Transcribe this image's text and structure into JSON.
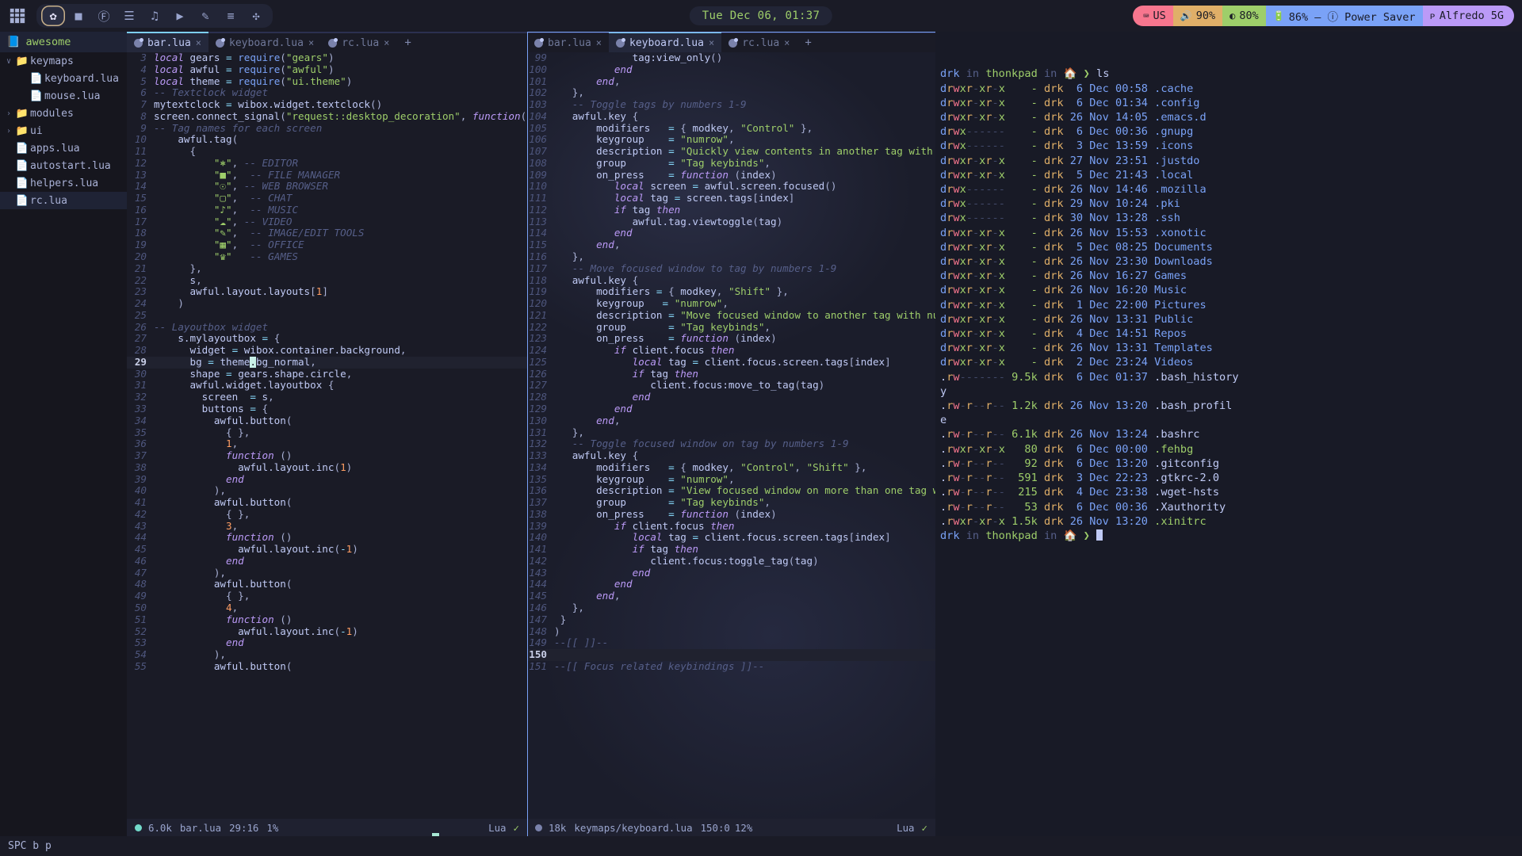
{
  "topbar": {
    "launcher_icon": "grid-apps-icon",
    "tags": [
      {
        "icon": "✿",
        "name": "editor-tag",
        "glyph": "emacs-icon",
        "active": true
      },
      {
        "icon": "■",
        "name": "file-manager-tag",
        "glyph": "folder-icon",
        "active": false
      },
      {
        "icon": "Ⓕ",
        "name": "web-browser-tag",
        "glyph": "firefox-icon",
        "active": false
      },
      {
        "icon": "☰",
        "name": "chat-tag",
        "glyph": "chat-icon",
        "active": false
      },
      {
        "icon": "♫",
        "name": "music-tag",
        "glyph": "music-icon",
        "active": false
      },
      {
        "icon": "▶",
        "name": "video-tag",
        "glyph": "video-icon",
        "active": false
      },
      {
        "icon": "✎",
        "name": "image-edit-tag",
        "glyph": "pencil-icon",
        "active": false
      },
      {
        "icon": "≡",
        "name": "office-tag",
        "glyph": "document-icon",
        "active": false
      },
      {
        "icon": "✣",
        "name": "games-tag",
        "glyph": "gamepad-icon",
        "active": false
      }
    ],
    "clock": "Tue Dec 06, 01:37",
    "tray": [
      {
        "name": "keyboard-layout",
        "icon": "⌨",
        "label": "US",
        "bg": "#f7768e"
      },
      {
        "name": "volume",
        "icon": "🔊",
        "label": "90%",
        "bg": "#e0af68"
      },
      {
        "name": "brightness",
        "icon": "◐",
        "label": "80%",
        "bg": "#9ece6a"
      },
      {
        "name": "battery",
        "icon": "🔋",
        "label": "86% – ⓘ Power Saver",
        "bg": "#7aa2f7"
      },
      {
        "name": "wifi",
        "icon": "ᴘ",
        "label": "Alfredo 5G",
        "bg": "#bb9af7"
      }
    ]
  },
  "sidebar": {
    "root": {
      "label": "awesome",
      "icon": "book-icon"
    },
    "items": [
      {
        "label": "keymaps",
        "type": "folder",
        "chev": "∨",
        "indent": 0,
        "selected": false
      },
      {
        "label": "keyboard.lua",
        "type": "file",
        "chev": "",
        "indent": 1,
        "selected": false
      },
      {
        "label": "mouse.lua",
        "type": "file",
        "chev": "",
        "indent": 1,
        "selected": false
      },
      {
        "label": "modules",
        "type": "folder",
        "chev": "›",
        "indent": 0,
        "selected": false
      },
      {
        "label": "ui",
        "type": "folder",
        "chev": "›",
        "indent": 0,
        "selected": false
      },
      {
        "label": "apps.lua",
        "type": "file",
        "chev": "",
        "indent": 0,
        "selected": false
      },
      {
        "label": "autostart.lua",
        "type": "file",
        "chev": "",
        "indent": 0,
        "selected": false
      },
      {
        "label": "helpers.lua",
        "type": "file",
        "chev": "",
        "indent": 0,
        "selected": false
      },
      {
        "label": "rc.lua",
        "type": "file",
        "chev": "",
        "indent": 0,
        "selected": true
      }
    ]
  },
  "editor_left": {
    "tabs": [
      {
        "label": "bar.lua",
        "active": true,
        "close": "×"
      },
      {
        "label": "keyboard.lua",
        "active": false,
        "close": "×"
      },
      {
        "label": "rc.lua",
        "active": false,
        "close": "×"
      }
    ],
    "tab_add": "+",
    "first_line": 3,
    "cursor_line": 29,
    "statusline": {
      "dot_color": "#73daca",
      "size": "6.0k",
      "file": "bar.lua",
      "position": "29:16",
      "percent": "1%",
      "filetype": "Lua",
      "check": "✓"
    }
  },
  "editor_right": {
    "tabs": [
      {
        "label": "bar.lua",
        "active": false,
        "close": "×"
      },
      {
        "label": "keyboard.lua",
        "active": true,
        "close": "×"
      },
      {
        "label": "rc.lua",
        "active": false,
        "close": "×"
      }
    ],
    "tab_add": "+",
    "first_line": 99,
    "cursor_line": 150,
    "statusline": {
      "dot_color": "#7a82ab",
      "size": "18k",
      "file": "keymaps/keyboard.lua",
      "position": "150:0",
      "percent": "12%",
      "filetype": "Lua",
      "check": "✓"
    }
  },
  "terminal": {
    "prompt_user": "drk",
    "prompt_in": "in",
    "prompt_host": "thonkpad",
    "prompt_in2": "in",
    "prompt_dir_icon": "🏠",
    "prompt_arrow": "❯",
    "command": "ls",
    "entries": [
      {
        "perm": "drwxr-xr-x",
        "size": "-",
        "owner": "drk",
        "date": " 6 Dec 00:58",
        "name": ".cache",
        "color": "blue"
      },
      {
        "perm": "drwxr-xr-x",
        "size": "-",
        "owner": "drk",
        "date": " 6 Dec 01:34",
        "name": ".config",
        "color": "blue"
      },
      {
        "perm": "drwxr-xr-x",
        "size": "-",
        "owner": "drk",
        "date": "26 Nov 14:05",
        "name": ".emacs.d",
        "color": "blue"
      },
      {
        "perm": "drwx------",
        "size": "-",
        "owner": "drk",
        "date": " 6 Dec 00:36",
        "name": ".gnupg",
        "color": "blue"
      },
      {
        "perm": "drwx------",
        "size": "-",
        "owner": "drk",
        "date": " 3 Dec 13:59",
        "name": ".icons",
        "color": "blue"
      },
      {
        "perm": "drwxr-xr-x",
        "size": "-",
        "owner": "drk",
        "date": "27 Nov 23:51",
        "name": ".justdo",
        "color": "blue"
      },
      {
        "perm": "drwxr-xr-x",
        "size": "-",
        "owner": "drk",
        "date": " 5 Dec 21:43",
        "name": ".local",
        "color": "blue"
      },
      {
        "perm": "drwx------",
        "size": "-",
        "owner": "drk",
        "date": "26 Nov 14:46",
        "name": ".mozilla",
        "color": "blue"
      },
      {
        "perm": "drwx------",
        "size": "-",
        "owner": "drk",
        "date": "29 Nov 10:24",
        "name": ".pki",
        "color": "blue"
      },
      {
        "perm": "drwx------",
        "size": "-",
        "owner": "drk",
        "date": "30 Nov 13:28",
        "name": ".ssh",
        "color": "blue"
      },
      {
        "perm": "drwxr-xr-x",
        "size": "-",
        "owner": "drk",
        "date": "26 Nov 15:53",
        "name": ".xonotic",
        "color": "blue"
      },
      {
        "perm": "drwxr-xr-x",
        "size": "-",
        "owner": "drk",
        "date": " 5 Dec 08:25",
        "name": "Documents",
        "color": "blue"
      },
      {
        "perm": "drwxr-xr-x",
        "size": "-",
        "owner": "drk",
        "date": "26 Nov 23:30",
        "name": "Downloads",
        "color": "blue"
      },
      {
        "perm": "drwxr-xr-x",
        "size": "-",
        "owner": "drk",
        "date": "26 Nov 16:27",
        "name": "Games",
        "color": "blue"
      },
      {
        "perm": "drwxr-xr-x",
        "size": "-",
        "owner": "drk",
        "date": "26 Nov 16:20",
        "name": "Music",
        "color": "blue"
      },
      {
        "perm": "drwxr-xr-x",
        "size": "-",
        "owner": "drk",
        "date": " 1 Dec 22:00",
        "name": "Pictures",
        "color": "blue"
      },
      {
        "perm": "drwxr-xr-x",
        "size": "-",
        "owner": "drk",
        "date": "26 Nov 13:31",
        "name": "Public",
        "color": "blue"
      },
      {
        "perm": "drwxr-xr-x",
        "size": "-",
        "owner": "drk",
        "date": " 4 Dec 14:51",
        "name": "Repos",
        "color": "blue"
      },
      {
        "perm": "drwxr-xr-x",
        "size": "-",
        "owner": "drk",
        "date": "26 Nov 13:31",
        "name": "Templates",
        "color": "blue"
      },
      {
        "perm": "drwxr-xr-x",
        "size": "-",
        "owner": "drk",
        "date": " 2 Dec 23:24",
        "name": "Videos",
        "color": "blue"
      },
      {
        "perm": ".rw-------",
        "size": "9.5k",
        "owner": "drk",
        "date": " 6 Dec 01:37",
        "name": ".bash_history",
        "color": "white",
        "wrap": "y"
      },
      {
        "perm": ".rw-r--r--",
        "size": "1.2k",
        "owner": "drk",
        "date": "26 Nov 13:20",
        "name": ".bash_profil",
        "color": "white",
        "wrap": "e"
      },
      {
        "perm": ".rw-r--r--",
        "size": "6.1k",
        "owner": "drk",
        "date": "26 Nov 13:24",
        "name": ".bashrc",
        "color": "white"
      },
      {
        "perm": ".rwxr-xr-x",
        "size": "80",
        "owner": "drk",
        "date": " 6 Dec 00:00",
        "name": ".fehbg",
        "color": "green"
      },
      {
        "perm": ".rw-r--r--",
        "size": "92",
        "owner": "drk",
        "date": " 6 Dec 13:20",
        "name": ".gitconfig",
        "color": "white"
      },
      {
        "perm": ".rw-r--r--",
        "size": "591",
        "owner": "drk",
        "date": " 3 Dec 22:23",
        "name": ".gtkrc-2.0",
        "color": "white"
      },
      {
        "perm": ".rw-r--r--",
        "size": "215",
        "owner": "drk",
        "date": " 4 Dec 23:38",
        "name": ".wget-hsts",
        "color": "white"
      },
      {
        "perm": ".rw-r--r--",
        "size": "53",
        "owner": "drk",
        "date": " 6 Dec 00:36",
        "name": ".Xauthority",
        "color": "white"
      },
      {
        "perm": ".rwxr-xr-x",
        "size": "1.5k",
        "owner": "drk",
        "date": "26 Nov 13:20",
        "name": ".xinitrc",
        "color": "green"
      }
    ]
  },
  "bottombar": {
    "keys": "SPC b p"
  }
}
